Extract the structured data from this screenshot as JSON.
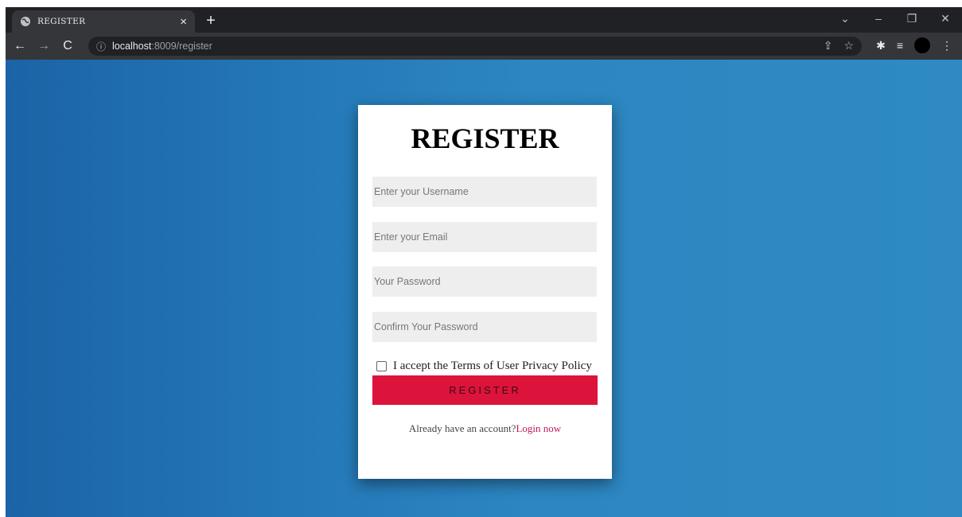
{
  "browser": {
    "tab_title": "REGISTER",
    "tab_close": "×",
    "new_tab": "+",
    "url_host": "localhost",
    "url_path": ":8009/register",
    "window_controls": {
      "chevron": "⌄",
      "minimize": "–",
      "restore": "❐",
      "close": "✕"
    }
  },
  "form": {
    "heading": "REGISTER",
    "username_placeholder": "Enter your Username",
    "email_placeholder": "Enter your Email",
    "password_placeholder": "Your Password",
    "confirm_placeholder": "Confirm Your Password",
    "terms_label": "I accept the Terms of User Privacy Policy",
    "terms_checked": false,
    "submit_label": "REGISTER",
    "login_prompt": "Already have an account?",
    "login_link": "Login now"
  },
  "colors": {
    "accent": "#dc143c",
    "background_left": "#1b63a6",
    "background_right": "#2f8ac3",
    "link": "#c2185b"
  }
}
